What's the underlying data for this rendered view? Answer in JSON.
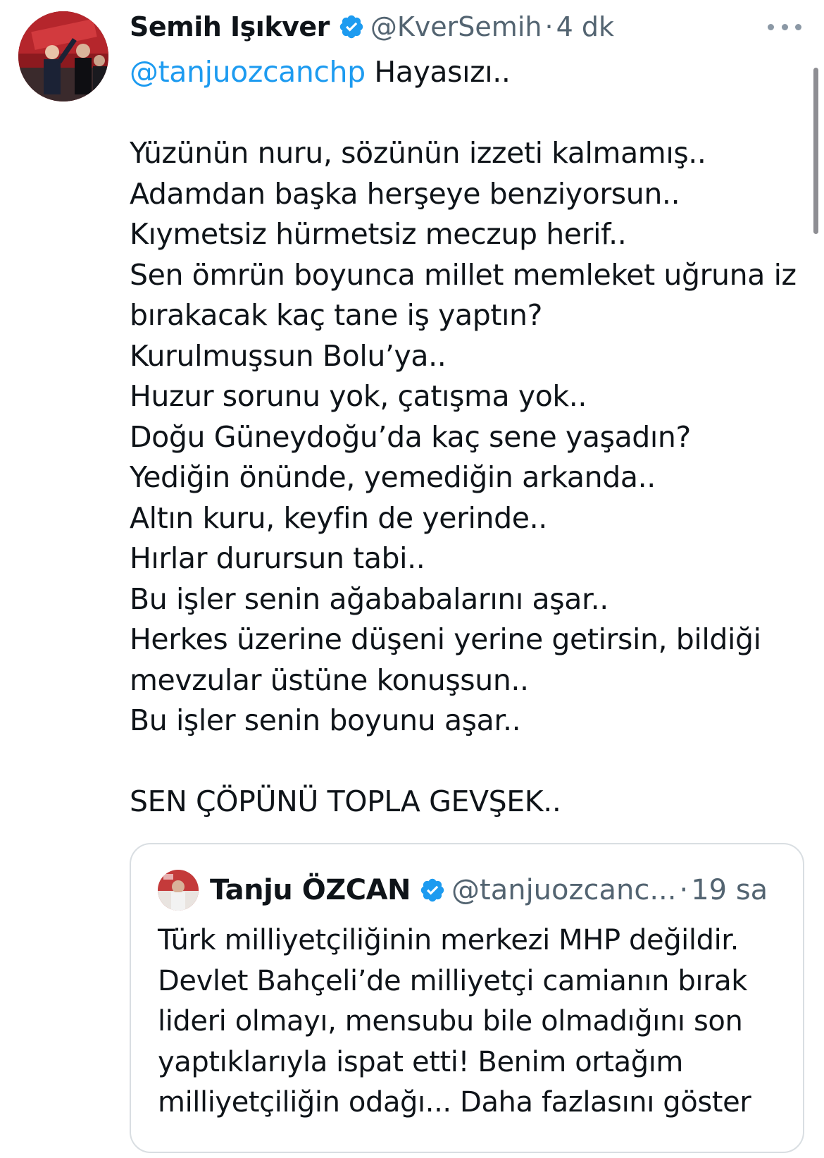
{
  "tweet": {
    "author": {
      "name": "Semih Işıkver",
      "handle": "@KverSemih",
      "separator": "·",
      "time": "4 dk",
      "avatar_icon": "profile-photo"
    },
    "reply_to": "@tanjuozcanchp",
    "first_line_rest": " Hayasızı..",
    "lines": [
      "Yüzünün nuru, sözünün izzeti kalmamış..",
      "Adamdan başka herşeye benziyorsun..",
      "Kıymetsiz hürmetsiz meczup herif..",
      "Sen ömrün boyunca millet memleket uğruna iz",
      "bırakacak kaç tane iş yaptın?",
      "Kurulmuşsun Bolu’ya..",
      "Huzur sorunu yok, çatışma yok..",
      "Doğu Güneydoğu’da kaç sene yaşadın?",
      "Yediğin önünde, yemediğin arkanda..",
      "Altın kuru, keyfin de yerinde..",
      "Hırlar durursun tabi..",
      "Bu işler senin ağababalarını aşar..",
      "Herkes üzerine düşeni yerine getirsin, bildiği",
      "mevzular üstüne konuşsun..",
      "Bu işler senin boyunu aşar.."
    ],
    "closing": "SEN ÇÖPÜNÜ TOPLA GEVŞEK..",
    "more_icon": "more-dots-icon",
    "verified_icon": "verified-badge-icon"
  },
  "quote": {
    "author": {
      "name": "Tanju ÖZCAN",
      "handle": "@tanjuozcanc...",
      "separator": "·",
      "time": "19 sa"
    },
    "lines": [
      "Türk milliyetçiliğinin merkezi MHP değildir.",
      "Devlet Bahçeli’de milliyetçi camianın bırak",
      "lideri olmayı, mensubu bile olmadığını son",
      "yaptıklarıyla ispat etti! Benim ortağım"
    ],
    "last_line": "milliyetçiliğin odağı...",
    "show_more": "Daha fazlasını göster"
  },
  "colors": {
    "link": "#1d9bf0",
    "text": "#0f1419",
    "secondary": "#536471",
    "border": "#d9dee2"
  }
}
